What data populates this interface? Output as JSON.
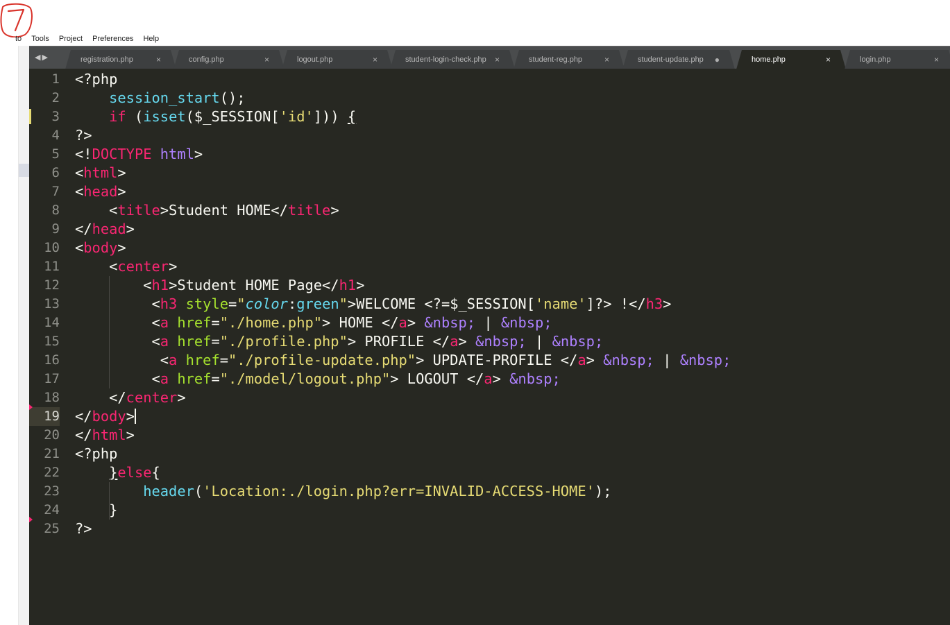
{
  "menubar": {
    "items": [
      "to",
      "Tools",
      "Project",
      "Preferences",
      "Help"
    ]
  },
  "annotation": {
    "mark": "7"
  },
  "tabbar": {
    "arrows_icon": "tab-scroll-arrows-icon",
    "tabs": [
      {
        "label": "registration.php",
        "close": "×",
        "active": false,
        "dirty": false
      },
      {
        "label": "config.php",
        "close": "×",
        "active": false,
        "dirty": false
      },
      {
        "label": "logout.php",
        "close": "×",
        "active": false,
        "dirty": false
      },
      {
        "label": "student-login-check.php",
        "close": "×",
        "active": false,
        "dirty": false
      },
      {
        "label": "student-reg.php",
        "close": "×",
        "active": false,
        "dirty": false
      },
      {
        "label": "student-update.php",
        "close": "●",
        "active": false,
        "dirty": true
      },
      {
        "label": "home.php",
        "close": "×",
        "active": true,
        "dirty": false
      },
      {
        "label": "login.php",
        "close": "×",
        "active": false,
        "dirty": false
      }
    ]
  },
  "editor": {
    "theme": {
      "background": "#272822",
      "foreground": "#f8f8f2",
      "tag": "#f92672",
      "attr": "#a6e22e",
      "string": "#e6db74",
      "function": "#66d9ef",
      "entity": "#ae81ff"
    },
    "current_line": 19,
    "modified_lines": [
      3
    ],
    "error_lines": [
      19,
      25
    ],
    "lines": [
      {
        "n": "1",
        "tokens": [
          [
            "pl",
            "<?php"
          ]
        ]
      },
      {
        "n": "2",
        "tokens": [
          [
            "pl",
            "    "
          ],
          [
            "fn",
            "session_start"
          ],
          [
            "pl",
            "();"
          ]
        ]
      },
      {
        "n": "3",
        "tokens": [
          [
            "pl",
            "    "
          ],
          [
            "kw",
            "if"
          ],
          [
            "pl",
            " ("
          ],
          [
            "fn",
            "isset"
          ],
          [
            "pl",
            "($_SESSION["
          ],
          [
            "str",
            "'id'"
          ],
          [
            "pl",
            "])) "
          ],
          [
            "ul",
            "{"
          ]
        ]
      },
      {
        "n": "4",
        "tokens": [
          [
            "pl",
            "?>"
          ]
        ]
      },
      {
        "n": "5",
        "tokens": [
          [
            "pl",
            "<!"
          ],
          [
            "tag",
            "DOCTYPE"
          ],
          [
            "pl",
            " "
          ],
          [
            "ent",
            "html"
          ],
          [
            "pl",
            ">"
          ]
        ]
      },
      {
        "n": "6",
        "tokens": [
          [
            "pl",
            "<"
          ],
          [
            "tag",
            "html"
          ],
          [
            "pl",
            ">"
          ]
        ]
      },
      {
        "n": "7",
        "tokens": [
          [
            "pl",
            "<"
          ],
          [
            "tag",
            "head"
          ],
          [
            "pl",
            ">"
          ]
        ]
      },
      {
        "n": "8",
        "tokens": [
          [
            "pl",
            "    <"
          ],
          [
            "tag",
            "title"
          ],
          [
            "pl",
            ">Student HOME</"
          ],
          [
            "tag",
            "title"
          ],
          [
            "pl",
            ">"
          ]
        ]
      },
      {
        "n": "9",
        "tokens": [
          [
            "pl",
            "</"
          ],
          [
            "tag",
            "head"
          ],
          [
            "pl",
            ">"
          ]
        ]
      },
      {
        "n": "10",
        "tokens": [
          [
            "pl",
            "<"
          ],
          [
            "tag",
            "body"
          ],
          [
            "pl",
            ">"
          ]
        ]
      },
      {
        "n": "11",
        "tokens": [
          [
            "pl",
            "    <"
          ],
          [
            "tag",
            "center"
          ],
          [
            "pl",
            ">"
          ]
        ]
      },
      {
        "n": "12",
        "tokens": [
          [
            "pl",
            "        <"
          ],
          [
            "tag",
            "h1"
          ],
          [
            "pl",
            ">Student HOME Page</"
          ],
          [
            "tag",
            "h1"
          ],
          [
            "pl",
            ">"
          ]
        ]
      },
      {
        "n": "13",
        "tokens": [
          [
            "pl",
            "         <"
          ],
          [
            "tag",
            "h3"
          ],
          [
            "pl",
            " "
          ],
          [
            "attr",
            "style"
          ],
          [
            "pl",
            "="
          ],
          [
            "str",
            "\""
          ],
          [
            "it",
            "color"
          ],
          [
            "pl",
            ":"
          ],
          [
            "fn",
            "green"
          ],
          [
            "str",
            "\""
          ],
          [
            "pl",
            ">WELCOME <?=$_SESSION["
          ],
          [
            "str",
            "'name'"
          ],
          [
            "pl",
            "]?> !</"
          ],
          [
            "tag",
            "h3"
          ],
          [
            "pl",
            ">"
          ]
        ]
      },
      {
        "n": "14",
        "tokens": [
          [
            "pl",
            "         <"
          ],
          [
            "tag",
            "a"
          ],
          [
            "pl",
            " "
          ],
          [
            "attr",
            "href"
          ],
          [
            "pl",
            "="
          ],
          [
            "str",
            "\"./home.php\""
          ],
          [
            "pl",
            "> HOME </"
          ],
          [
            "tag",
            "a"
          ],
          [
            "pl",
            "> "
          ],
          [
            "ent",
            "&nbsp;"
          ],
          [
            "pl",
            " | "
          ],
          [
            "ent",
            "&nbsp;"
          ]
        ]
      },
      {
        "n": "15",
        "tokens": [
          [
            "pl",
            "         <"
          ],
          [
            "tag",
            "a"
          ],
          [
            "pl",
            " "
          ],
          [
            "attr",
            "href"
          ],
          [
            "pl",
            "="
          ],
          [
            "str",
            "\"./profile.php\""
          ],
          [
            "pl",
            "> PROFILE </"
          ],
          [
            "tag",
            "a"
          ],
          [
            "pl",
            "> "
          ],
          [
            "ent",
            "&nbsp;"
          ],
          [
            "pl",
            " | "
          ],
          [
            "ent",
            "&nbsp;"
          ]
        ]
      },
      {
        "n": "16",
        "tokens": [
          [
            "pl",
            "          <"
          ],
          [
            "tag",
            "a"
          ],
          [
            "pl",
            " "
          ],
          [
            "attr",
            "href"
          ],
          [
            "pl",
            "="
          ],
          [
            "str",
            "\"./profile-update.php\""
          ],
          [
            "pl",
            "> UPDATE-PROFILE </"
          ],
          [
            "tag",
            "a"
          ],
          [
            "pl",
            "> "
          ],
          [
            "ent",
            "&nbsp;"
          ],
          [
            "pl",
            " | "
          ],
          [
            "ent",
            "&nbsp;"
          ]
        ]
      },
      {
        "n": "17",
        "tokens": [
          [
            "pl",
            "         <"
          ],
          [
            "tag",
            "a"
          ],
          [
            "pl",
            " "
          ],
          [
            "attr",
            "href"
          ],
          [
            "pl",
            "="
          ],
          [
            "str",
            "\"./model/logout.php\""
          ],
          [
            "pl",
            "> LOGOUT </"
          ],
          [
            "tag",
            "a"
          ],
          [
            "pl",
            "> "
          ],
          [
            "ent",
            "&nbsp;"
          ]
        ]
      },
      {
        "n": "18",
        "tokens": [
          [
            "pl",
            "    </"
          ],
          [
            "tag",
            "center"
          ],
          [
            "pl",
            ">"
          ]
        ]
      },
      {
        "n": "19",
        "tokens": [
          [
            "pl",
            "</"
          ],
          [
            "tag",
            "body"
          ],
          [
            "pl",
            ">"
          ]
        ]
      },
      {
        "n": "20",
        "tokens": [
          [
            "pl",
            "</"
          ],
          [
            "tag",
            "html"
          ],
          [
            "pl",
            ">"
          ]
        ]
      },
      {
        "n": "21",
        "tokens": [
          [
            "pl",
            "<?php"
          ]
        ]
      },
      {
        "n": "22",
        "tokens": [
          [
            "pl",
            "    "
          ],
          [
            "ul",
            "}"
          ],
          [
            "kw",
            "else"
          ],
          [
            "pl",
            "{"
          ]
        ]
      },
      {
        "n": "23",
        "tokens": [
          [
            "pl",
            "        "
          ],
          [
            "fn",
            "header"
          ],
          [
            "pl",
            "("
          ],
          [
            "str",
            "'Location:./login.php?err=INVALID-ACCESS-HOME'"
          ],
          [
            "pl",
            ");"
          ]
        ]
      },
      {
        "n": "24",
        "tokens": [
          [
            "pl",
            "    }"
          ]
        ]
      },
      {
        "n": "25",
        "tokens": [
          [
            "pl",
            "?>"
          ]
        ]
      }
    ]
  }
}
